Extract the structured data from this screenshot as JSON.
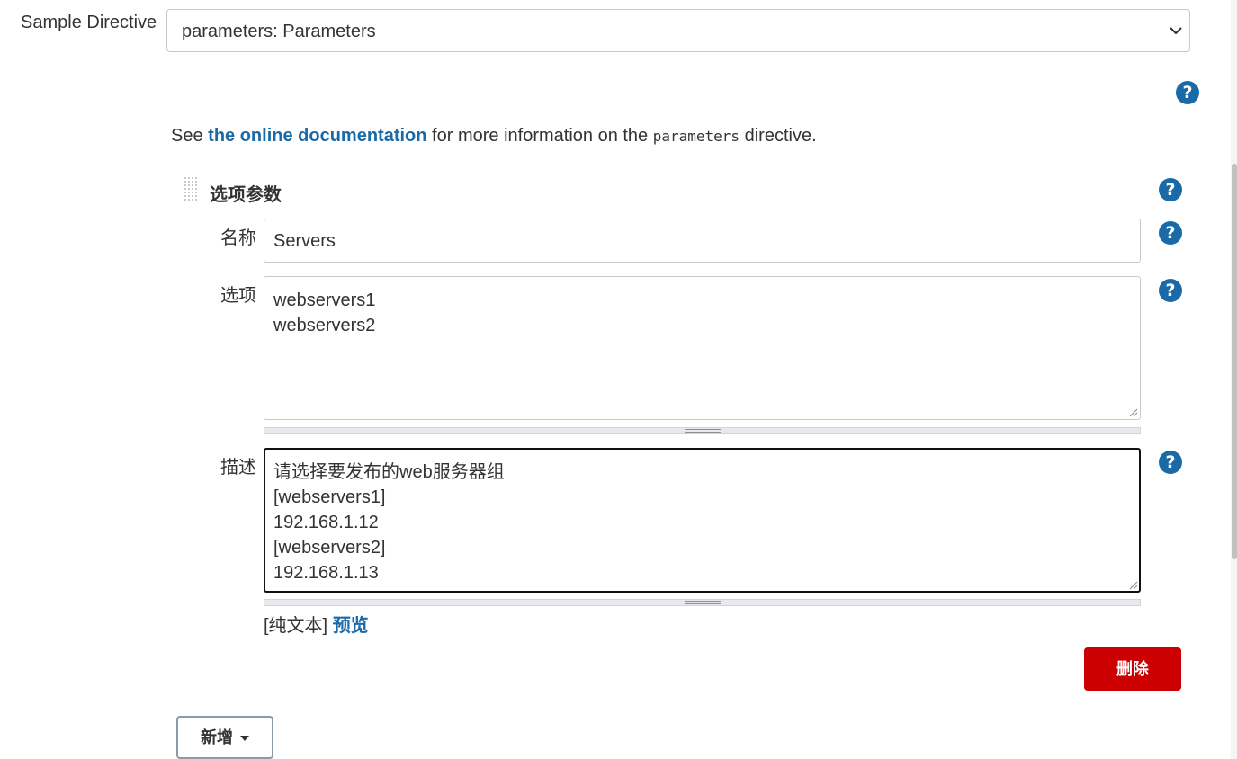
{
  "directive": {
    "label": "Sample Directive",
    "selected": "parameters: Parameters"
  },
  "doc": {
    "prefix": "See ",
    "link": "the online documentation",
    "middle": " for more information on the ",
    "code": "parameters",
    "suffix": " directive."
  },
  "section": {
    "title": "选项参数"
  },
  "fields": {
    "name_label": "名称",
    "name_value": "Servers",
    "choices_label": "选项",
    "choices_value": "webservers1\nwebservers2",
    "desc_label": "描述",
    "desc_value": "请选择要发布的web服务器组\n[webservers1]\n192.168.1.12\n[webservers2]\n192.168.1.13"
  },
  "format": {
    "plain": "[纯文本]",
    "preview": "预览"
  },
  "buttons": {
    "delete": "删除",
    "add": "新增"
  },
  "icons": {
    "help": "?"
  },
  "colors": {
    "accent": "#1a6aa8",
    "danger": "#cc0000"
  }
}
